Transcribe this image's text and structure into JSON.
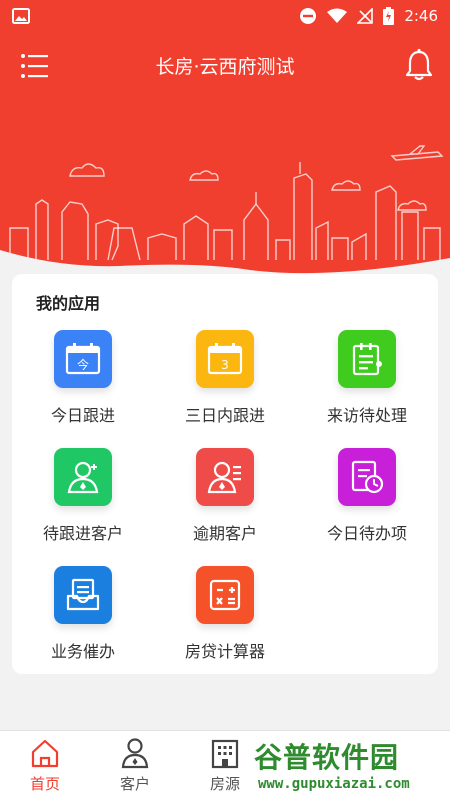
{
  "status_bar": {
    "time": "2:46"
  },
  "header": {
    "title": "长房·云西府测试"
  },
  "apps_section": {
    "title": "我的应用",
    "items": [
      {
        "label": "今日跟进",
        "icon": "calendar-today-icon",
        "badge": "今",
        "color": "#3b82f6"
      },
      {
        "label": "三日内跟进",
        "icon": "calendar-three-icon",
        "badge": "3",
        "color": "#fbb60f"
      },
      {
        "label": "来访待处理",
        "icon": "notepad-icon",
        "color": "#3fcc1e"
      },
      {
        "label": "待跟进客户",
        "icon": "client-pending-icon",
        "color": "#1fc864"
      },
      {
        "label": "逾期客户",
        "icon": "client-overdue-icon",
        "color": "#ef4b48"
      },
      {
        "label": "今日待办项",
        "icon": "todo-clock-icon",
        "color": "#c820d8"
      },
      {
        "label": "业务催办",
        "icon": "inbox-tray-icon",
        "color": "#1b7fe0"
      },
      {
        "label": "房贷计算器",
        "icon": "calculator-icon",
        "color": "#f5522a"
      }
    ]
  },
  "tabbar": {
    "items": [
      {
        "label": "首页",
        "icon": "home-icon",
        "active": true
      },
      {
        "label": "客户",
        "icon": "person-icon",
        "active": false
      },
      {
        "label": "房源",
        "icon": "building-icon",
        "active": false
      }
    ]
  },
  "watermark": {
    "cn": "谷普软件园",
    "en": "www.gupuxiazai.com"
  },
  "colors": {
    "primary": "#f03e2f",
    "background": "#f2f2f2"
  }
}
